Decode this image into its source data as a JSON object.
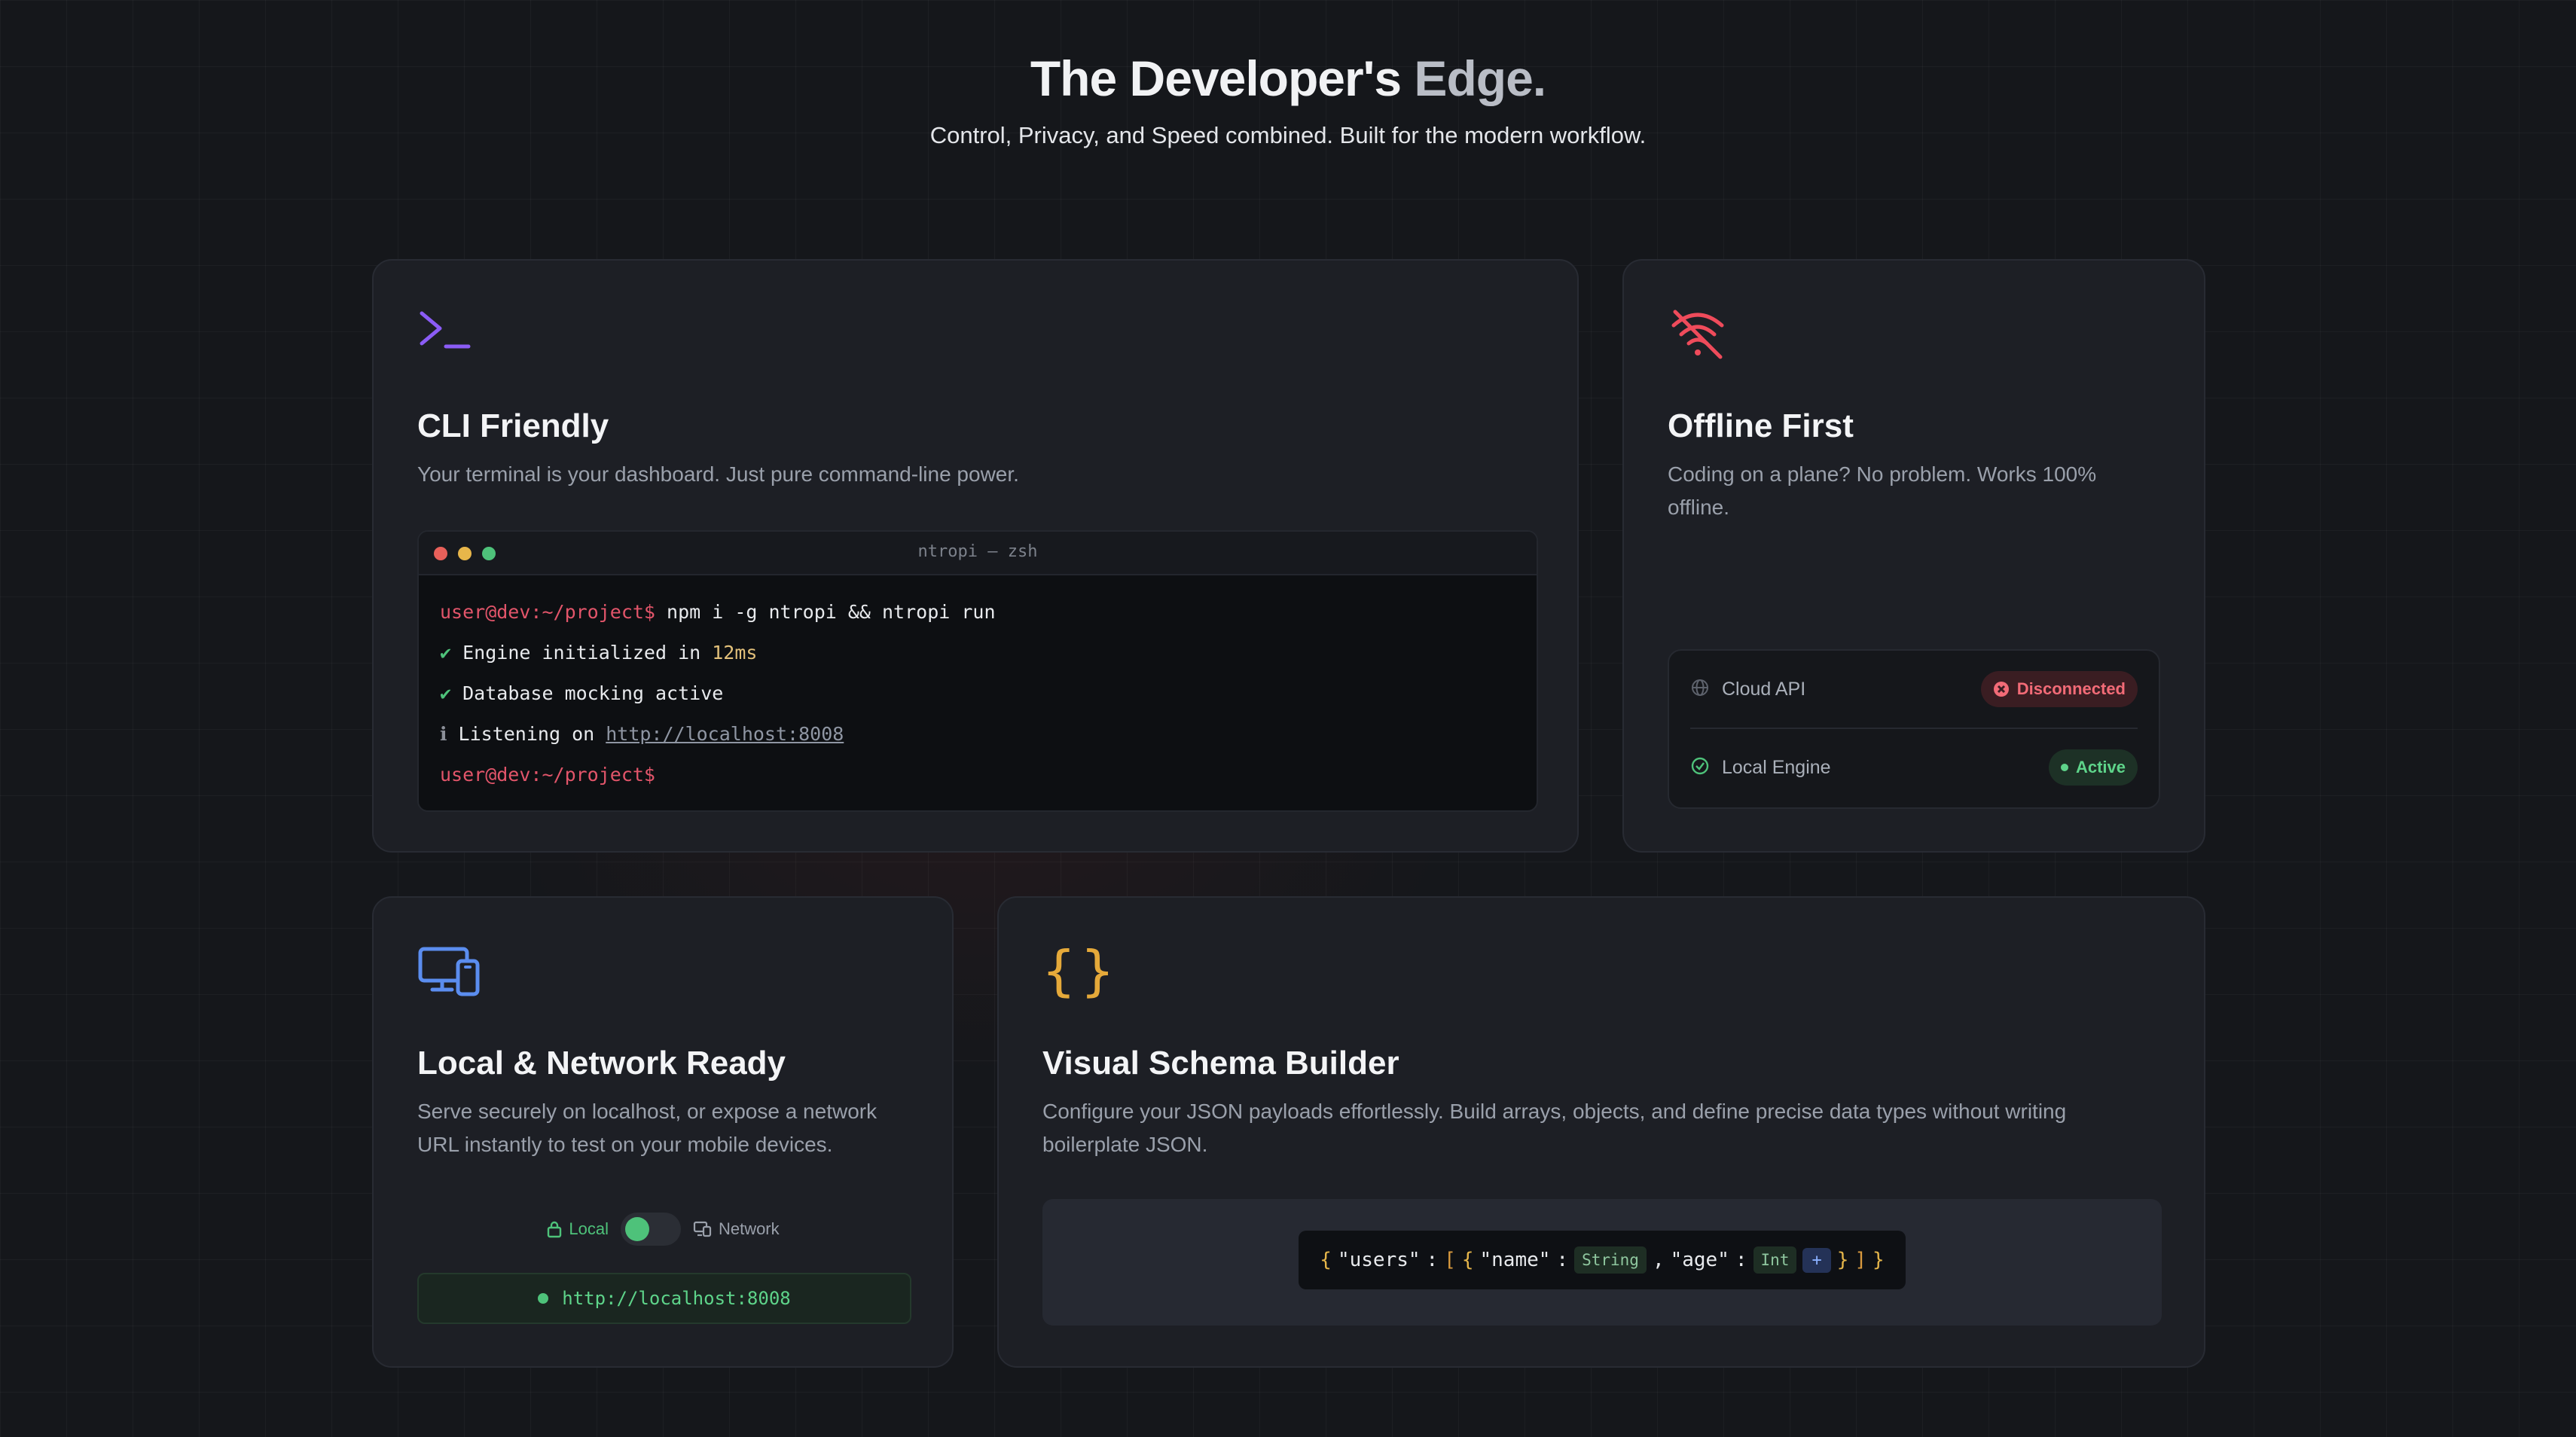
{
  "header": {
    "title_main": "The Developer's ",
    "title_fade": "Edge.",
    "subtitle": "Control, Privacy, and Speed combined. Built for the modern workflow."
  },
  "colors": {
    "background": "#15171b",
    "card": "#1d1f25",
    "purple": "#8b5cf6",
    "red": "#ef4b5b",
    "blue": "#5b8def",
    "amber": "#e5a93a",
    "green": "#4ec27a"
  },
  "cards": {
    "cli": {
      "icon": "terminal-prompt-icon",
      "title": "CLI Friendly",
      "description": "Your terminal is your dashboard. Just pure command-line power.",
      "terminal": {
        "title": "ntropi — zsh",
        "prompt": "user@dev:~/project$",
        "command": " npm i -g ntropi && ntropi run",
        "line1_mark": "✔",
        "line1_text": " Engine initialized in ",
        "line1_value": "12ms",
        "line2_mark": "✔",
        "line2_text": " Database mocking active",
        "line3_mark": "ℹ",
        "line3_text": " Listening on ",
        "line3_link": "http://localhost:8008",
        "final_prompt": "user@dev:~/project$"
      }
    },
    "offline": {
      "icon": "wifi-off-icon",
      "title": "Offline First",
      "description": "Coding on a plane? No problem. Works 100% offline.",
      "services": [
        {
          "icon": "globe-icon",
          "label": "Cloud API",
          "status": "Disconnected"
        },
        {
          "icon": "check-circle-icon",
          "label": "Local Engine",
          "status": "Active"
        }
      ]
    },
    "local": {
      "icon": "devices-icon",
      "title": "Local & Network Ready",
      "description": "Serve securely on localhost, or expose a network URL instantly to test on your mobile devices.",
      "toggle_left": "Local",
      "toggle_right": "Network",
      "url": "http://localhost:8008"
    },
    "schema": {
      "icon": "curly-braces-icon",
      "title": "Visual Schema Builder",
      "description": "Configure your JSON payloads effortlessly. Build arrays, objects, and define precise data types without writing boilerplate JSON.",
      "code": {
        "open": "{",
        "key_users": "\"users\"",
        "colon1": ":",
        "arr_open": "[",
        "obj_open": "{",
        "key_name": "\"name\"",
        "colon2": ":",
        "type_name": "String",
        "comma": ",",
        "key_age": "\"age\"",
        "colon3": ":",
        "type_age": "Int",
        "add": "+",
        "obj_close": "}",
        "arr_close": "]",
        "close": "}"
      }
    }
  }
}
